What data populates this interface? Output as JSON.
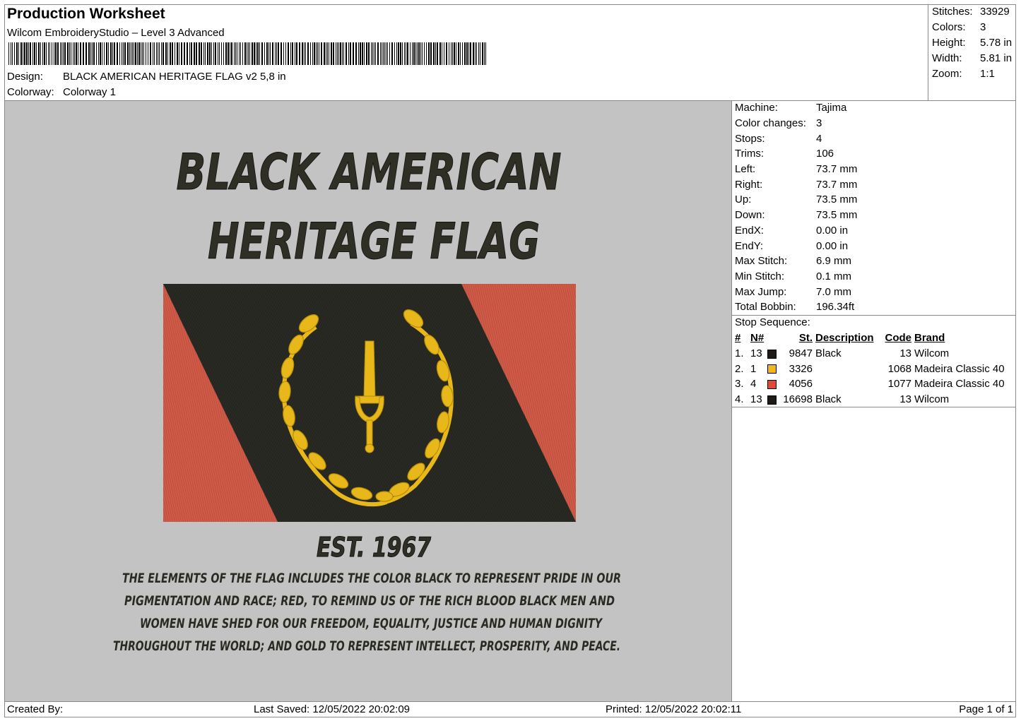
{
  "header": {
    "title": "Production Worksheet",
    "software": "Wilcom EmbroideryStudio – Level 3 Advanced",
    "design_label": "Design:",
    "design_value": "BLACK AMERICAN HERITAGE FLAG v2 5,8 in",
    "colorway_label": "Colorway:",
    "colorway_value": "Colorway 1"
  },
  "summary": [
    {
      "label": "Stitches:",
      "value": "33929"
    },
    {
      "label": "Colors:",
      "value": "3"
    },
    {
      "label": "Height:",
      "value": "5.78 in"
    },
    {
      "label": "Width:",
      "value": "5.81 in"
    },
    {
      "label": "Zoom:",
      "value": "1:1"
    }
  ],
  "machine": [
    {
      "label": "Machine:",
      "value": "Tajima"
    },
    {
      "label": "Color changes:",
      "value": "3"
    },
    {
      "label": "Stops:",
      "value": "4"
    },
    {
      "label": "Trims:",
      "value": "106"
    },
    {
      "label": "Left:",
      "value": "73.7 mm"
    },
    {
      "label": "Right:",
      "value": "73.7 mm"
    },
    {
      "label": "Up:",
      "value": "73.5 mm"
    },
    {
      "label": "Down:",
      "value": "73.5 mm"
    },
    {
      "label": "EndX:",
      "value": "0.00 in"
    },
    {
      "label": "EndY:",
      "value": "0.00 in"
    },
    {
      "label": "Max Stitch:",
      "value": "6.9 mm"
    },
    {
      "label": "Min Stitch:",
      "value": "0.1 mm"
    },
    {
      "label": "Max Jump:",
      "value": "7.0 mm"
    },
    {
      "label": "Total Bobbin:",
      "value": "196.34ft"
    }
  ],
  "stop_sequence": {
    "title": "Stop Sequence:",
    "columns": [
      "#",
      "N#",
      "St.",
      "Description",
      "Code",
      "Brand"
    ],
    "rows": [
      {
        "num": "1.",
        "needle": "13",
        "color": "#1f1a17",
        "stitches": "9847",
        "description": "Black",
        "code": "13",
        "brand": "Wilcom"
      },
      {
        "num": "2.",
        "needle": "1",
        "color": "#f1b81c",
        "stitches": "3326",
        "description": "",
        "code": "1068",
        "brand": "Madeira Classic 40"
      },
      {
        "num": "3.",
        "needle": "4",
        "color": "#e0483a",
        "stitches": "4056",
        "description": "",
        "code": "1077",
        "brand": "Madeira Classic 40"
      },
      {
        "num": "4.",
        "needle": "13",
        "color": "#1f1a17",
        "stitches": "16698",
        "description": "Black",
        "code": "13",
        "brand": "Wilcom"
      }
    ]
  },
  "design": {
    "title_line1": "BLACK AMERICAN",
    "title_line2": "HERITAGE FLAG",
    "est": "EST. 1967",
    "text_lines": [
      "THE ELEMENTS OF THE FLAG INCLUDES THE COLOR BLACK TO REPRESENT PRIDE IN OUR",
      "PIGMENTATION AND RACE; RED, TO REMIND US OF THE RICH BLOOD BLACK MEN AND",
      "WOMEN HAVE SHED FOR OUR FREEDOM, EQUALITY, JUSTICE AND HUMAN DIGNITY",
      "THROUGHOUT THE WORLD; AND GOLD TO REPRESENT INTELLECT, PROSPERITY, AND PEACE."
    ],
    "colors": {
      "black": "#2a2a24",
      "red": "#cf5a48",
      "gold": "#e8b81a",
      "background": "#c3c3c3"
    }
  },
  "footer": {
    "created": "Created By:",
    "saved": "Last Saved: 12/05/2022 20:02:09",
    "printed": "Printed: 12/05/2022 20:02:11",
    "page": "Page 1 of 1"
  }
}
